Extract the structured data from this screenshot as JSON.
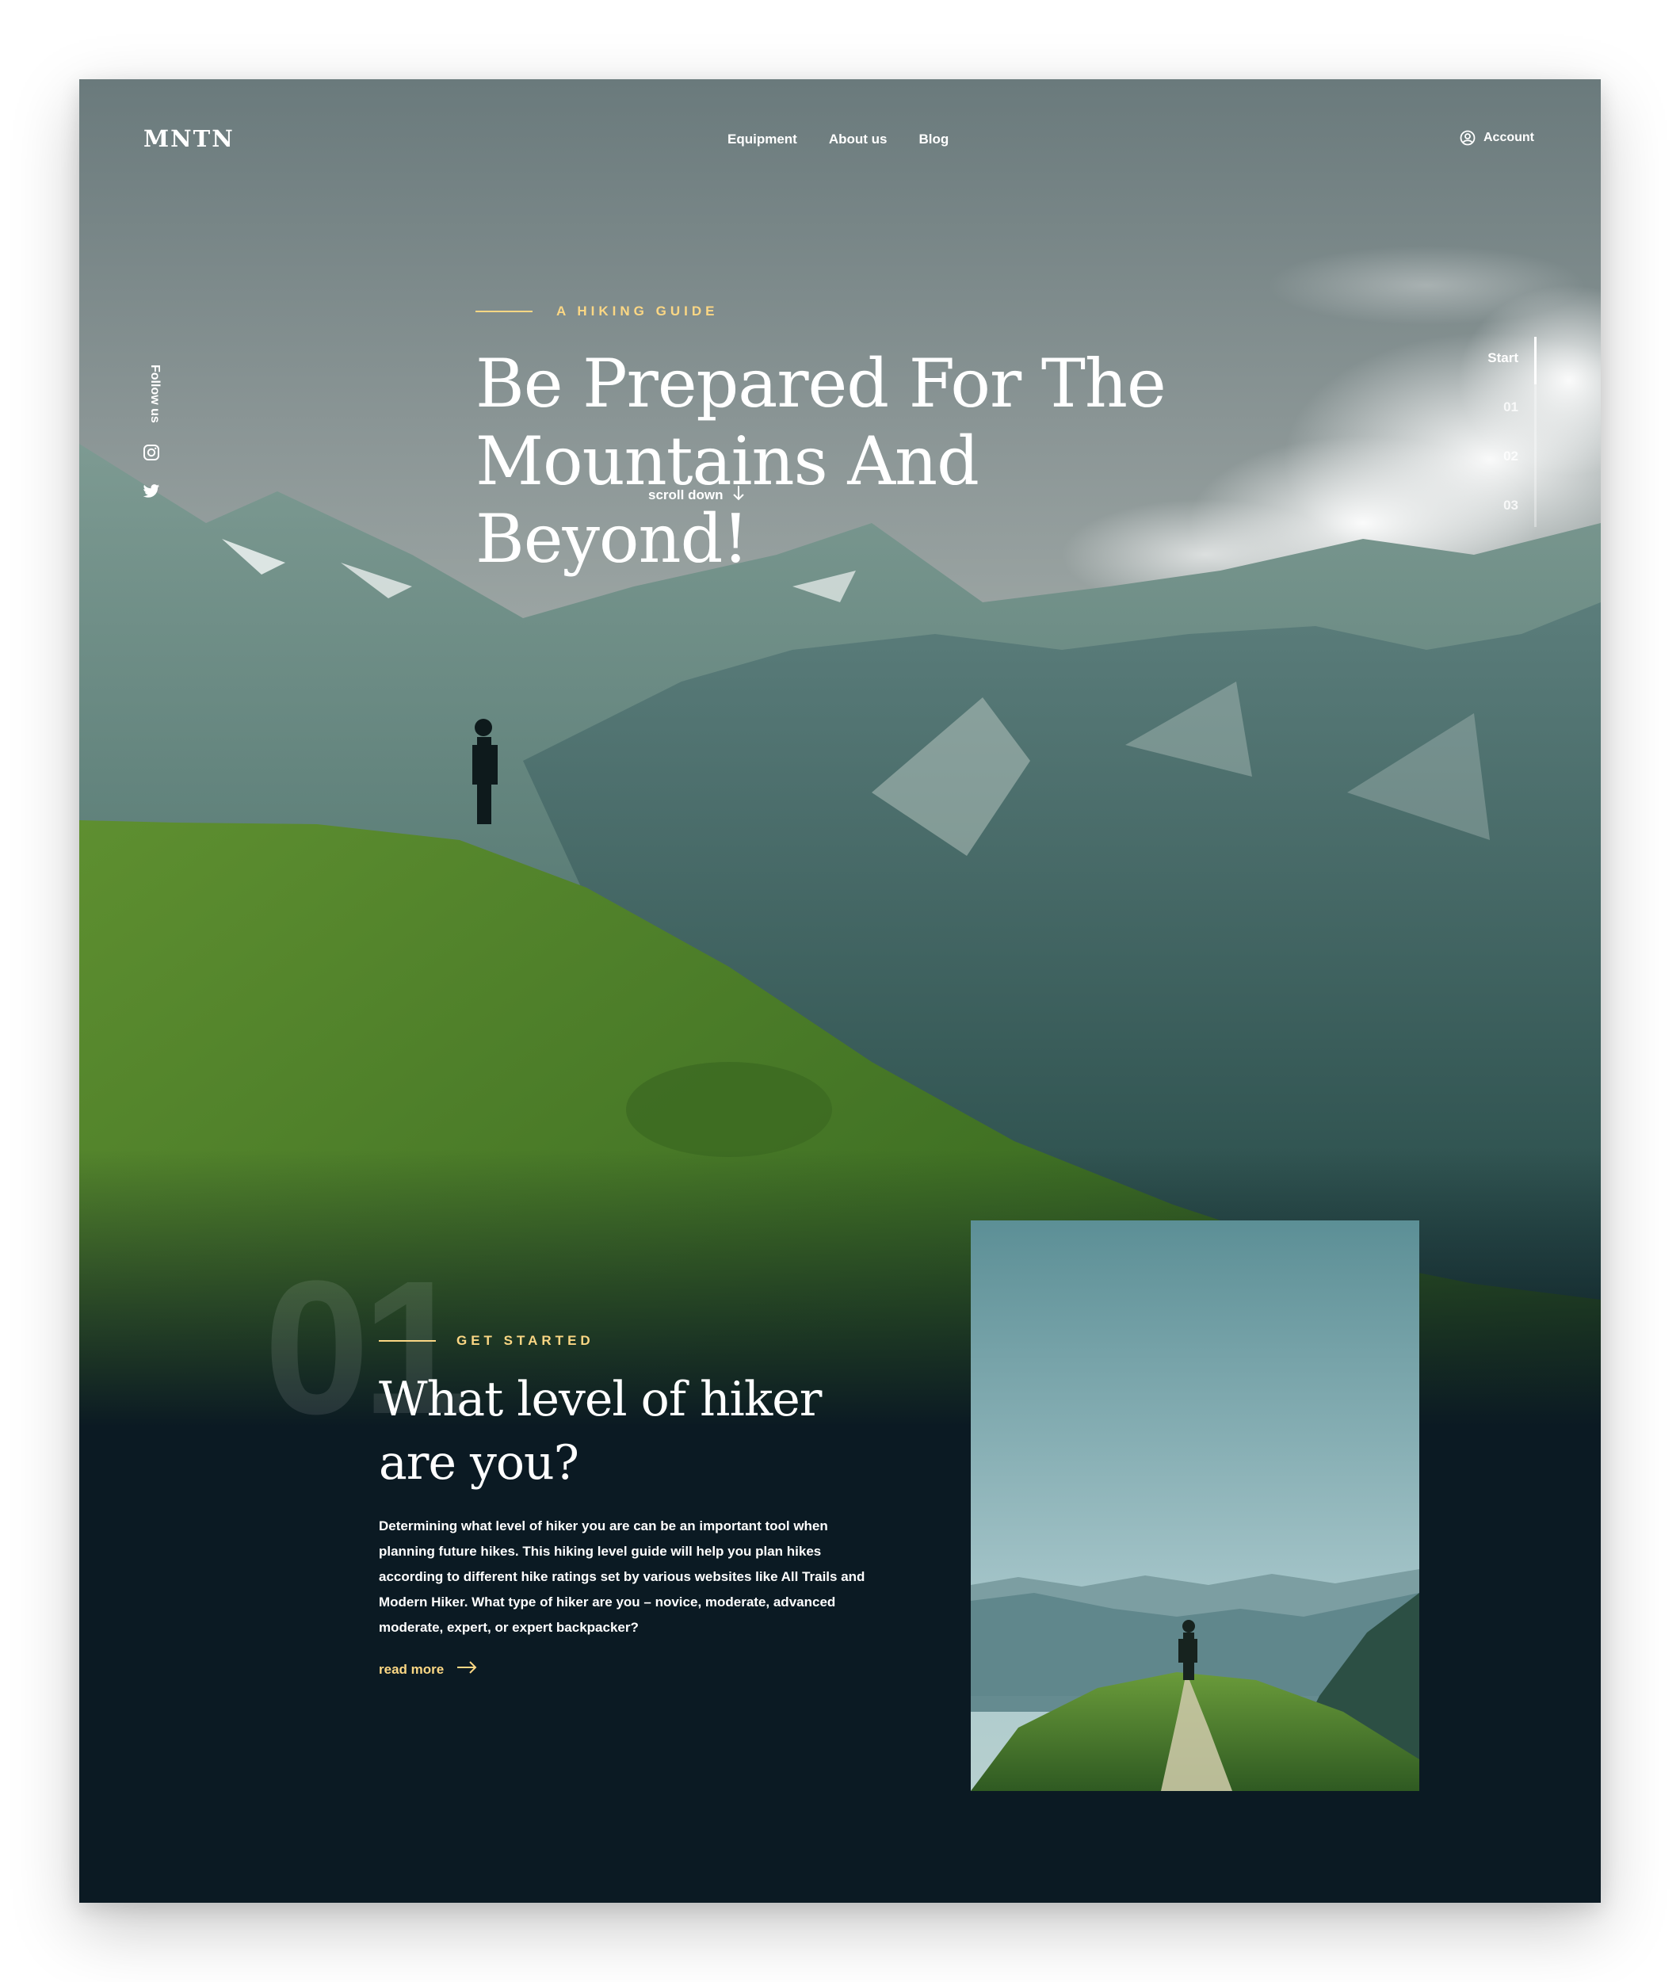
{
  "brand": {
    "logo": "MNTN"
  },
  "nav": {
    "items": [
      "Equipment",
      "About us",
      "Blog"
    ]
  },
  "account": {
    "label": "Account"
  },
  "follow": {
    "label": "Follow us"
  },
  "hero": {
    "kicker": "A HIKING GUIDE",
    "title": "Be Prepared For The Mountains And Beyond!",
    "scroll": "scroll down"
  },
  "slides": {
    "items": [
      "Start",
      "01",
      "02",
      "03"
    ],
    "active": "Start"
  },
  "section": {
    "number": "01",
    "kicker": "GET STARTED",
    "title": "What level of  hiker are you?",
    "body": "Determining what level of hiker you are can be an important tool when planning future hikes. This hiking level guide will help you plan hikes according to different hike ratings set by various websites like All Trails and Modern Hiker. What type of hiker are you – novice, moderate, advanced moderate, expert, or expert backpacker?",
    "read_more": "read more"
  },
  "colors": {
    "accent": "#fbd784",
    "background_dark": "#0b1a23",
    "text": "#ffffff"
  },
  "icons": [
    "account-icon",
    "instagram-icon",
    "twitter-icon",
    "arrow-down-icon",
    "arrow-right-icon"
  ]
}
